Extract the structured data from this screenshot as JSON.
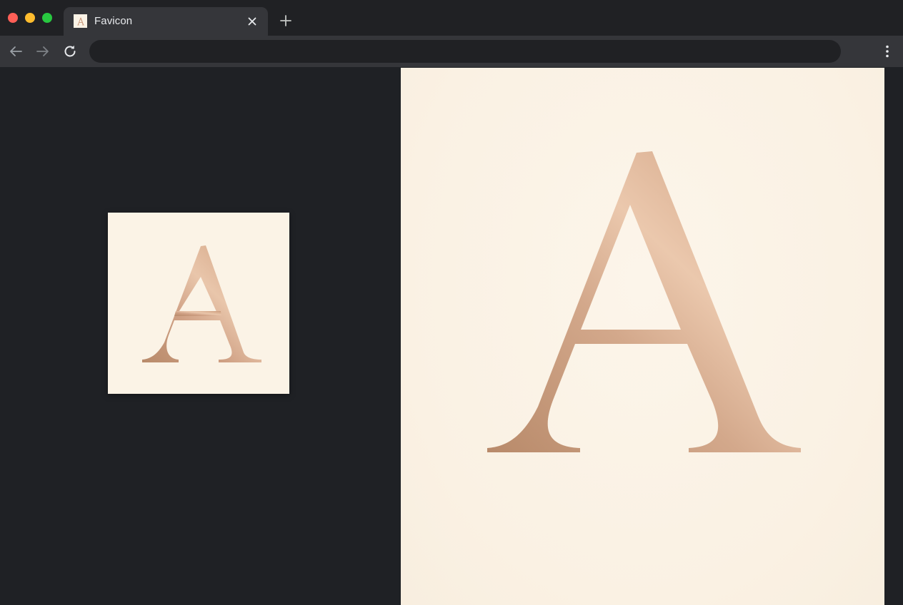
{
  "window": {
    "traffic_lights": {
      "close": "#ff5f57",
      "minimize": "#febc2e",
      "maximize": "#28c840"
    }
  },
  "tab": {
    "title": "Favicon",
    "favicon_icon": "letter-a-icon"
  },
  "toolbar": {
    "address_value": "",
    "icons": [
      "back-arrow-icon",
      "forward-arrow-icon",
      "reload-icon",
      "kebab-menu-icon"
    ]
  },
  "page": {
    "background": "#1f2125",
    "favicon_preview_small": {
      "letter": "A",
      "background": "#fbf3e6"
    },
    "favicon_preview_large": {
      "letter": "A",
      "background": "#faf1e3"
    },
    "colors": {
      "rose_gold_dark": "#bf9373",
      "rose_gold_light": "#ebc7ab"
    }
  }
}
